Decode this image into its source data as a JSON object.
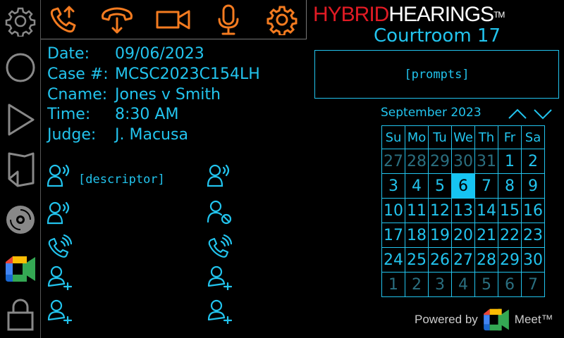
{
  "sidebar": {
    "items": [
      "settings-icon",
      "circle-icon",
      "play-icon",
      "folder-icon",
      "disc-icon",
      "meet-icon",
      "lock-icon"
    ]
  },
  "toolbar": {
    "items": [
      "call-transfer-icon",
      "hangup-icon",
      "video-icon",
      "microphone-icon",
      "gear-icon"
    ],
    "accent": "#f47b20"
  },
  "info": {
    "date_label": "Date:",
    "date": "09/06/2023",
    "case_label": "Case #:",
    "case": "MCSC2023C154LH",
    "cname_label": "Cname:",
    "cname": "Jones v Smith",
    "time_label": "Time:",
    "time": "8:30 AM",
    "judge_label": "Judge:",
    "judge": "J. Macusa"
  },
  "participants": {
    "descriptor": "[descriptor]"
  },
  "brand": {
    "hybrid": "HYBRID",
    "hearings": "HEARINGS",
    "tm": "TM",
    "courtroom": "Courtroom 17"
  },
  "prompts": "[prompts]",
  "calendar": {
    "month": "September 2023",
    "days": [
      "Su",
      "Mo",
      "Tu",
      "We",
      "Th",
      "Fr",
      "Sa"
    ],
    "weeks": [
      [
        [
          "27",
          1
        ],
        [
          "28",
          1
        ],
        [
          "29",
          1
        ],
        [
          "30",
          1
        ],
        [
          "31",
          1
        ],
        [
          "1",
          0
        ],
        [
          "2",
          0
        ]
      ],
      [
        [
          "3",
          0
        ],
        [
          "4",
          0
        ],
        [
          "5",
          0
        ],
        [
          "6",
          2
        ],
        [
          "7",
          0
        ],
        [
          "8",
          0
        ],
        [
          "9",
          0
        ]
      ],
      [
        [
          "10",
          0
        ],
        [
          "11",
          0
        ],
        [
          "12",
          0
        ],
        [
          "13",
          0
        ],
        [
          "14",
          0
        ],
        [
          "15",
          0
        ],
        [
          "16",
          0
        ]
      ],
      [
        [
          "17",
          0
        ],
        [
          "18",
          0
        ],
        [
          "19",
          0
        ],
        [
          "20",
          0
        ],
        [
          "21",
          0
        ],
        [
          "22",
          0
        ],
        [
          "23",
          0
        ]
      ],
      [
        [
          "24",
          0
        ],
        [
          "25",
          0
        ],
        [
          "26",
          0
        ],
        [
          "27",
          0
        ],
        [
          "28",
          0
        ],
        [
          "29",
          0
        ],
        [
          "30",
          0
        ]
      ],
      [
        [
          "1",
          1
        ],
        [
          "2",
          1
        ],
        [
          "3",
          1
        ],
        [
          "4",
          1
        ],
        [
          "5",
          1
        ],
        [
          "6",
          1
        ],
        [
          "7",
          1
        ]
      ]
    ]
  },
  "footer": {
    "powered": "Powered by",
    "meet": "Meet™"
  },
  "colors": {
    "cyan": "#22c4ee",
    "orange": "#f47b20",
    "red": "#e01b24"
  }
}
